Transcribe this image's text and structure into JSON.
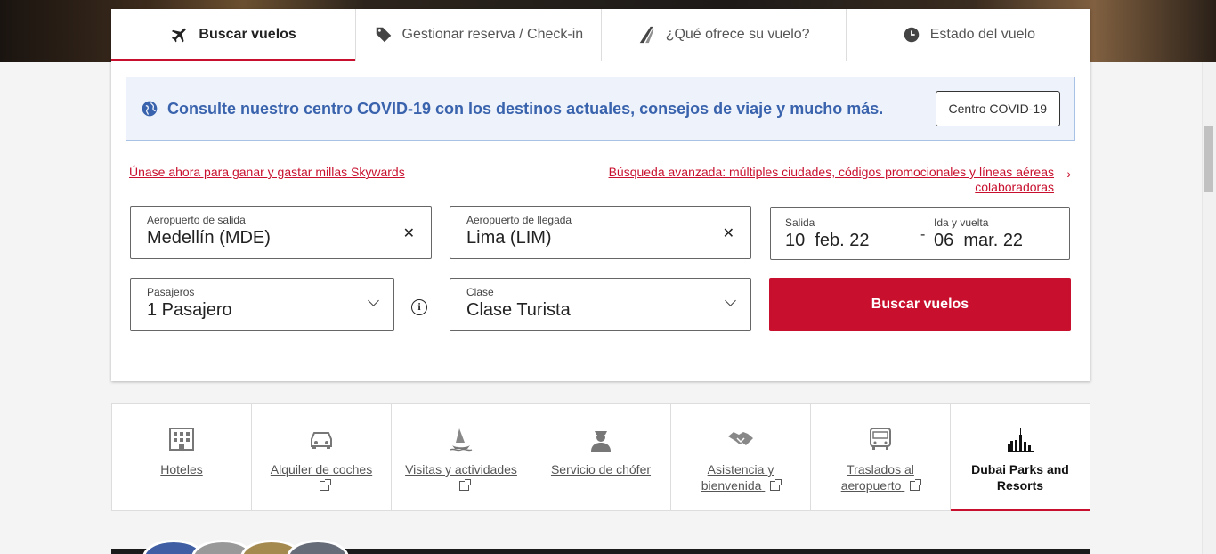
{
  "tabs": [
    {
      "label": "Buscar vuelos",
      "icon": "plane-icon",
      "active": true
    },
    {
      "label": "Gestionar reserva / Check-in",
      "icon": "tag-icon"
    },
    {
      "label": "¿Qué ofrece su vuelo?",
      "icon": "seat-icon"
    },
    {
      "label": "Estado del vuelo",
      "icon": "clock-icon"
    }
  ],
  "covid": {
    "message": "Consulte nuestro centro COVID-19 con los destinos actuales, consejos de viaje y mucho más.",
    "button": "Centro COVID-19"
  },
  "links": {
    "skywards": "Únase ahora para ganar y gastar millas Skywards",
    "advanced": "Búsqueda avanzada: múltiples ciudades, códigos promocionales y líneas aéreas colaboradoras"
  },
  "form": {
    "departure": {
      "label": "Aeropuerto de salida",
      "value": "Medellín (MDE)"
    },
    "arrival": {
      "label": "Aeropuerto de llegada",
      "value": "Lima (LIM)"
    },
    "dates": {
      "depart_label": "Salida",
      "depart_value": "10  feb. 22",
      "return_label": "Ida y vuelta",
      "return_value": "06  mar. 22",
      "separator": "-"
    },
    "passengers": {
      "label": "Pasajeros",
      "value": "1 Pasajero"
    },
    "class": {
      "label": "Clase",
      "value": "Clase Turista"
    },
    "search_button": "Buscar vuelos"
  },
  "services": [
    {
      "label": "Hoteles",
      "icon": "hotel-icon",
      "external": false
    },
    {
      "label": "Alquiler de coches",
      "icon": "car-icon",
      "external": true
    },
    {
      "label": "Visitas y actividades",
      "icon": "activities-icon",
      "external": true
    },
    {
      "label": "Servicio de chófer",
      "icon": "chauffeur-icon",
      "external": false
    },
    {
      "label": "Asistencia y bienvenida",
      "icon": "handshake-icon",
      "external": true
    },
    {
      "label": "Traslados al aeropuerto",
      "icon": "bus-icon",
      "external": true
    },
    {
      "label": "Dubai Parks and Resorts",
      "icon": "skyline-icon",
      "external": false,
      "active": true
    }
  ],
  "colors": {
    "brand": "#c8102e",
    "covid_text": "#3a63ad",
    "covid_bg": "#eef3fb"
  }
}
